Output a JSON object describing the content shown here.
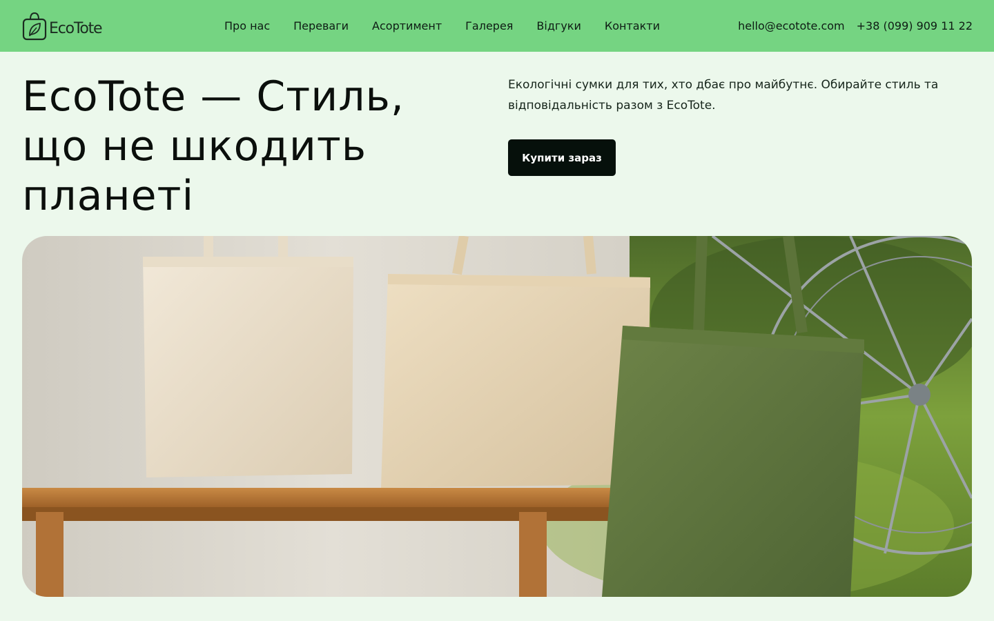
{
  "brand": {
    "name": "EcoTote",
    "logo_icon": "leaf-bag-icon"
  },
  "nav": {
    "items": [
      {
        "label": "Про нас"
      },
      {
        "label": "Переваги"
      },
      {
        "label": "Асортимент"
      },
      {
        "label": "Галерея"
      },
      {
        "label": "Відгуки"
      },
      {
        "label": "Контакти"
      }
    ]
  },
  "contacts": {
    "email": "hello@ecotote.com",
    "phone": "+38 (099) 909 11 22"
  },
  "hero": {
    "title": "EcoTote — Стиль, що не шкодить планеті",
    "description": "Екологічні сумки для тих, хто дбає про майбутнє. Обирайте стиль та відповідальність разом з EcoTote.",
    "cta_label": "Купити зараз"
  },
  "colors": {
    "header_bg": "#75D482",
    "page_bg": "#ECF8EC",
    "button_bg": "#06100B",
    "text": "#0B1A12"
  }
}
